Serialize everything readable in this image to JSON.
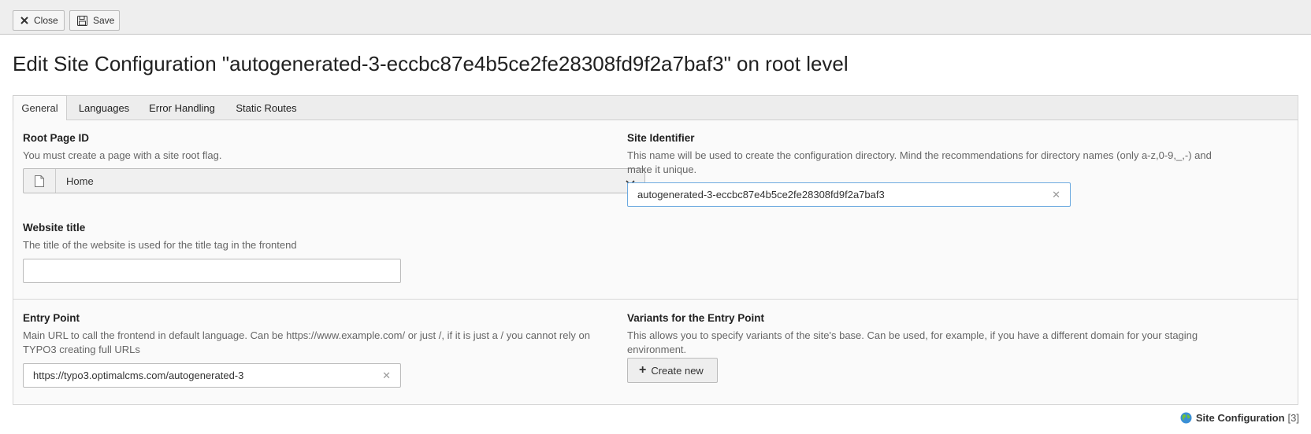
{
  "toolbar": {
    "close_label": "Close",
    "save_label": "Save"
  },
  "page_title": "Edit Site Configuration \"autogenerated-3-eccbc87e4b5ce2fe28308fd9f2a7baf3\" on root level",
  "tabs": [
    {
      "label": "General",
      "active": true
    },
    {
      "label": "Languages",
      "active": false
    },
    {
      "label": "Error Handling",
      "active": false
    },
    {
      "label": "Static Routes",
      "active": false
    }
  ],
  "fields": {
    "root_page": {
      "label": "Root Page ID",
      "description": "You must create a page with a site root flag.",
      "value": "Home",
      "icon": "page-icon"
    },
    "site_identifier": {
      "label": "Site Identifier",
      "description": "This name will be used to create the configuration directory. Mind the recommendations for directory names (only a-z,0-9,_,-) and make it unique.",
      "value": "autogenerated-3-eccbc87e4b5ce2fe28308fd9f2a7baf3"
    },
    "website_title": {
      "label": "Website title",
      "description": "The title of the website is used for the title tag in the frontend",
      "value": ""
    },
    "entry_point": {
      "label": "Entry Point",
      "description": "Main URL to call the frontend in default language. Can be https://www.example.com/ or just /, if it is just a / you cannot rely on TYPO3 creating full URLs",
      "value": "https://typo3.optimalcms.com/autogenerated-3"
    },
    "variants": {
      "label": "Variants for the Entry Point",
      "description": "This allows you to specify variants of the site's base. Can be used, for example, if you have a different domain for your staging environment.",
      "button_label": "Create new"
    }
  },
  "footer": {
    "record_type": "Site Configuration",
    "record_uid": "[3]",
    "icon": "globe-icon"
  },
  "colors": {
    "toolbar_bg": "#eeeeee",
    "panel_bg": "#fafafa",
    "focus_border": "#6daae0"
  }
}
